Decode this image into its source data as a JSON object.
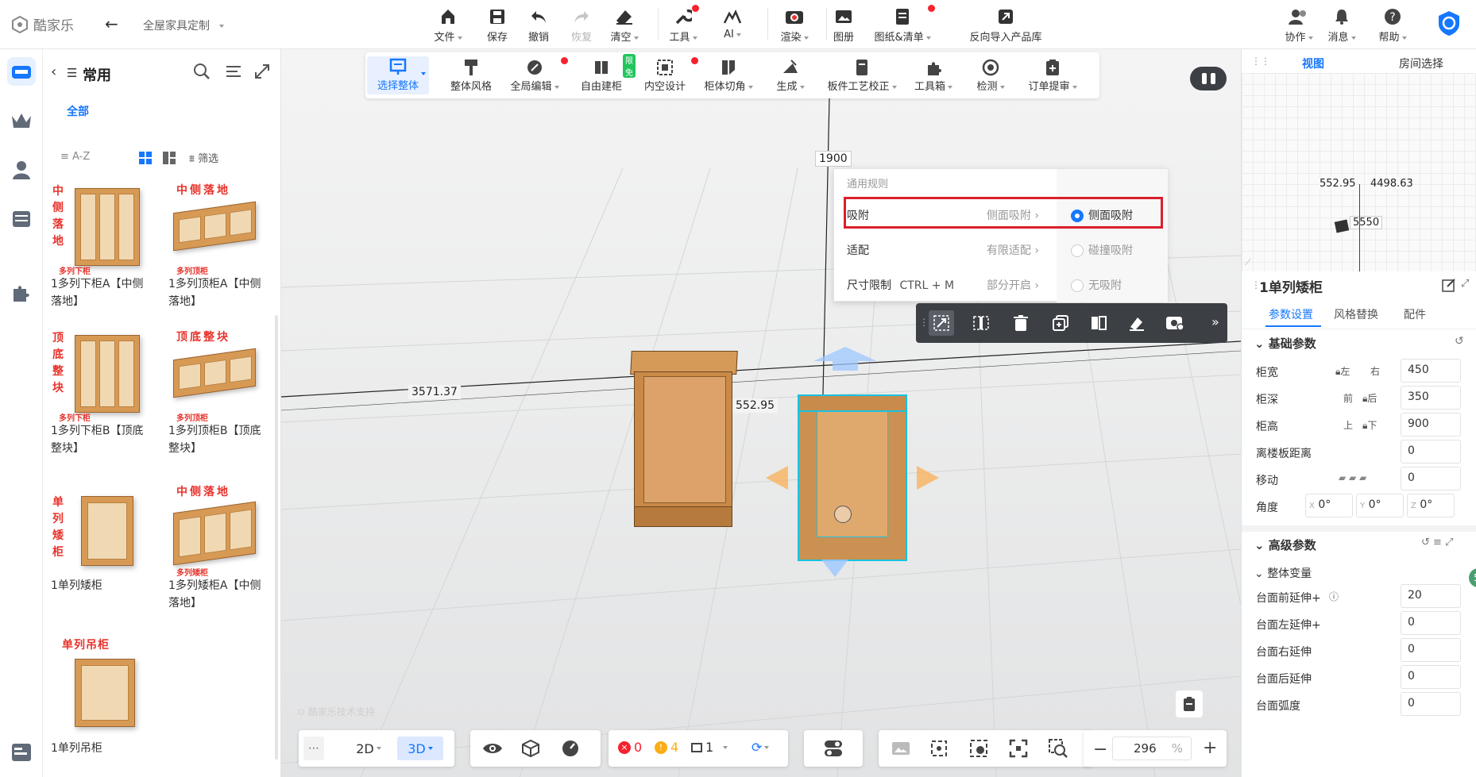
{
  "app": {
    "logo": "酷家乐",
    "project": "全屋家具定制"
  },
  "topbar": [
    {
      "label": "文件",
      "icon": "file-icon"
    },
    {
      "label": "保存",
      "icon": "save-icon"
    },
    {
      "label": "撤销",
      "icon": "undo-icon"
    },
    {
      "label": "恢复",
      "icon": "redo-icon"
    },
    {
      "label": "清空",
      "icon": "eraser-icon"
    },
    {
      "label": "工具",
      "icon": "wrench-icon"
    },
    {
      "label": "AI",
      "icon": "ai-icon"
    },
    {
      "label": "渲染",
      "icon": "camera-icon"
    },
    {
      "label": "图册",
      "icon": "album-icon"
    },
    {
      "label": "图纸&清单",
      "icon": "drawing-icon"
    },
    {
      "label": "反向导入产品库",
      "icon": "import-icon"
    }
  ],
  "topright": [
    {
      "label": "协作"
    },
    {
      "label": "消息"
    },
    {
      "label": "帮助"
    }
  ],
  "toolbar2": [
    {
      "label": "选择整体"
    },
    {
      "label": "整体风格"
    },
    {
      "label": "全局编辑"
    },
    {
      "label": "自由建柜",
      "badge": "限免"
    },
    {
      "label": "内空设计"
    },
    {
      "label": "柜体切角"
    },
    {
      "label": "生成"
    },
    {
      "label": "板件工艺校正"
    },
    {
      "label": "工具箱"
    },
    {
      "label": "检测"
    },
    {
      "label": "订单提审"
    }
  ],
  "library": {
    "title": "常用",
    "tab_all": "全部",
    "sort": "A-Z",
    "filter": "筛选",
    "items": [
      {
        "name": "1多列下柜A【中侧落地】",
        "tag": "中侧落地",
        "sub": "多列下柜"
      },
      {
        "name": "1多列顶柜A【中侧落地】",
        "tag": "中侧落地",
        "sub": "多列顶柜"
      },
      {
        "name": "1多列下柜B【顶底整块】",
        "tag": "顶底整块",
        "sub": "多列下柜"
      },
      {
        "name": "1多列顶柜B【顶底整块】",
        "tag": "顶底整块",
        "sub": "多列顶柜"
      },
      {
        "name": "1单列矮柜",
        "tag": "单列矮柜",
        "sub": ""
      },
      {
        "name": "1多列矮柜A【中侧落地】",
        "tag": "中侧落地",
        "sub": "多列矮柜"
      },
      {
        "name": "1单列吊柜",
        "tag": "单列吊柜",
        "sub": ""
      }
    ]
  },
  "canvas": {
    "dims": {
      "top": "1900",
      "left": "3571.37",
      "mid": "552.95"
    },
    "watermark": "酷家乐技术支持"
  },
  "popup": {
    "header": "通用规则",
    "rows": [
      {
        "label": "吸附",
        "value": "侧面吸附"
      },
      {
        "label": "适配",
        "value": "有限适配"
      },
      {
        "label": "尺寸限制",
        "shortcut": "CTRL + M",
        "value": "部分开启"
      }
    ],
    "options": [
      {
        "label": "侧面吸附",
        "checked": true
      },
      {
        "label": "碰撞吸附",
        "checked": false
      },
      {
        "label": "无吸附",
        "checked": false
      }
    ]
  },
  "bottom": {
    "mode2d": "2D",
    "mode3d": "3D",
    "err": "0",
    "warn": "4",
    "count": "1",
    "zoom": "296",
    "zoom_unit": "%"
  },
  "right": {
    "tabs": [
      "视图",
      "房间选择"
    ],
    "minimap": {
      "a": "552.95",
      "b": "4498.63",
      "c": "5550"
    },
    "title": "1单列矮柜",
    "ptabs": [
      "参数设置",
      "风格替换",
      "配件"
    ],
    "basic_title": "基础参数",
    "params": [
      {
        "k": "柜宽",
        "a": "左",
        "b": "右",
        "v": "450"
      },
      {
        "k": "柜深",
        "a": "前",
        "b": "后",
        "v": "350"
      },
      {
        "k": "柜高",
        "a": "上",
        "b": "下",
        "v": "900"
      },
      {
        "k": "离楼板距离",
        "v": "0"
      },
      {
        "k": "移动",
        "v": "0"
      }
    ],
    "angle": {
      "k": "角度",
      "x": "0°",
      "y": "0°",
      "z": "0°",
      "xl": "X",
      "yl": "Y",
      "zl": "Z"
    },
    "adv_title": "高级参数",
    "group": "整体变量",
    "adv": [
      {
        "k": "台面前延伸+",
        "v": "20"
      },
      {
        "k": "台面左延伸+",
        "v": "0"
      },
      {
        "k": "台面右延伸",
        "v": "0"
      },
      {
        "k": "台面后延伸",
        "v": "0"
      },
      {
        "k": "台面弧度",
        "v": "0"
      }
    ],
    "badge": "5"
  },
  "colors": {
    "accent": "#1677ff",
    "highlight": "#d9202c",
    "wood": "#d79a55"
  }
}
